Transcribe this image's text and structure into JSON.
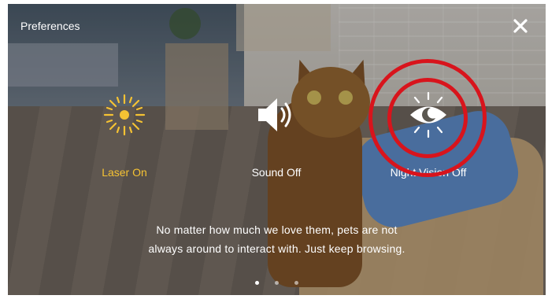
{
  "header": {
    "title": "Preferences",
    "close_icon": "close-icon"
  },
  "options": [
    {
      "label": "Laser On",
      "icon": "sun-icon",
      "color": "#f5c233",
      "state": "on"
    },
    {
      "label": "Sound Off",
      "icon": "speaker-icon",
      "color": "#ffffff",
      "state": "off"
    },
    {
      "label": "Night Vision Off",
      "icon": "eye-moon-icon",
      "color": "#ffffff",
      "state": "off"
    }
  ],
  "highlight": {
    "color": "#d8141c",
    "target": "Night Vision Off"
  },
  "caption": {
    "line1": "No matter how much we love them, pets are not",
    "line2": "always around to interact with. Just keep browsing."
  },
  "pager": {
    "count": 3,
    "active_index": 0
  },
  "colors": {
    "accent": "#f5c233",
    "text": "#ffffff"
  }
}
